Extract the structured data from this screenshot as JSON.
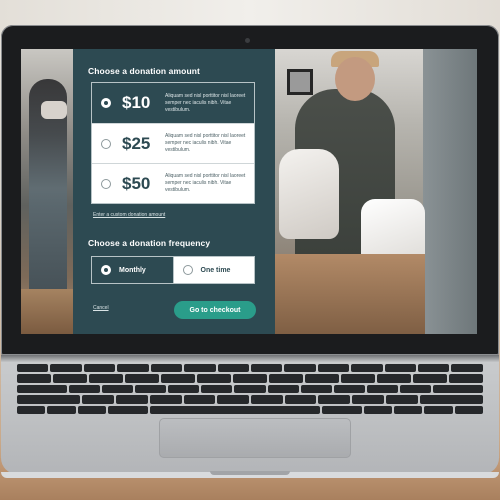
{
  "donation": {
    "amount_title": "Choose a donation amount",
    "amounts": [
      {
        "value": "$10",
        "description": "Aliquam sed nisl porttitor nisl laoreet semper nec iaculis nibh. Vitae vestibulum.",
        "selected": true
      },
      {
        "value": "$25",
        "description": "Aliquam sed nisl porttitor nisl laoreet semper nec iaculis nibh. Vitae vestibulum.",
        "selected": false
      },
      {
        "value": "$50",
        "description": "Aliquam sed nisl porttitor nisl laoreet semper nec iaculis nibh. Vitae vestibulum.",
        "selected": false
      }
    ],
    "custom_link": "Enter a custom donation amount",
    "frequency_title": "Choose a donation frequency",
    "frequencies": [
      {
        "label": "Monthly",
        "selected": true
      },
      {
        "label": "One time",
        "selected": false
      }
    ],
    "cancel_label": "Cancel",
    "checkout_label": "Go to checkout"
  },
  "colors": {
    "panel": "#2d4a52",
    "accent": "#2a9d8a",
    "option_bg": "#ffffff"
  }
}
